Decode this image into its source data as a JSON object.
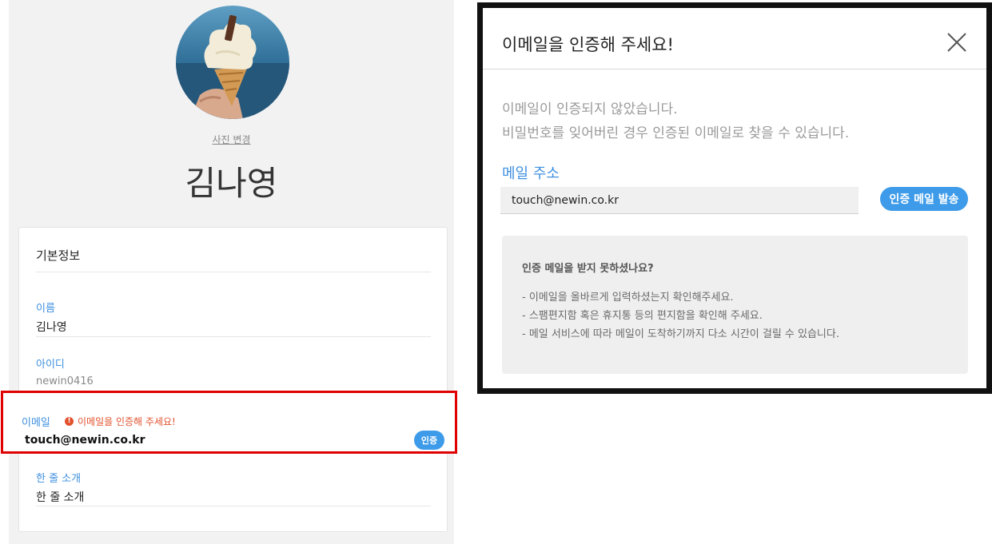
{
  "profile": {
    "photo_change_label": "사진 변경",
    "name": "김나영"
  },
  "card": {
    "title": "기본정보",
    "name_label": "이름",
    "name_value": "김나영",
    "id_label": "아이디",
    "id_value": "newin0416",
    "email_label": "이메일",
    "email_warning_icon": "!",
    "email_warning": "이메일을 인증해 주세요!",
    "email_value": "touch@newin.co.kr",
    "verify_button": "인증",
    "intro_label": "한 줄 소개",
    "intro_value": "한 줄 소개"
  },
  "modal": {
    "title": "이메일을 인증해 주세요!",
    "close_icon": "close-icon",
    "desc_line1": "이메일이 인증되지 않았습니다.",
    "desc_line2": "비밀번호를 잊어버린 경우 인증된 이메일로 찾을 수 있습니다.",
    "mail_label": "메일 주소",
    "mail_value": "touch@newin.co.kr",
    "send_button": "인증 메일 발송",
    "help": {
      "title": "인증 메일을 받지 못하셨나요?",
      "items": [
        "- 이메일을 올바르게 입력하셨는지 확인해주세요.",
        "- 스팸편지함 혹은 휴지통 등의 편지함을 확인해 주세요.",
        "- 메일 서비스에 따라 메일이 도착하기까지 다소 시간이 걸릴 수 있습니다."
      ]
    }
  },
  "colors": {
    "accent": "#3d9be9",
    "label_blue": "#3d8fe0",
    "warning": "#e2522e",
    "highlight_border": "#e00000"
  }
}
